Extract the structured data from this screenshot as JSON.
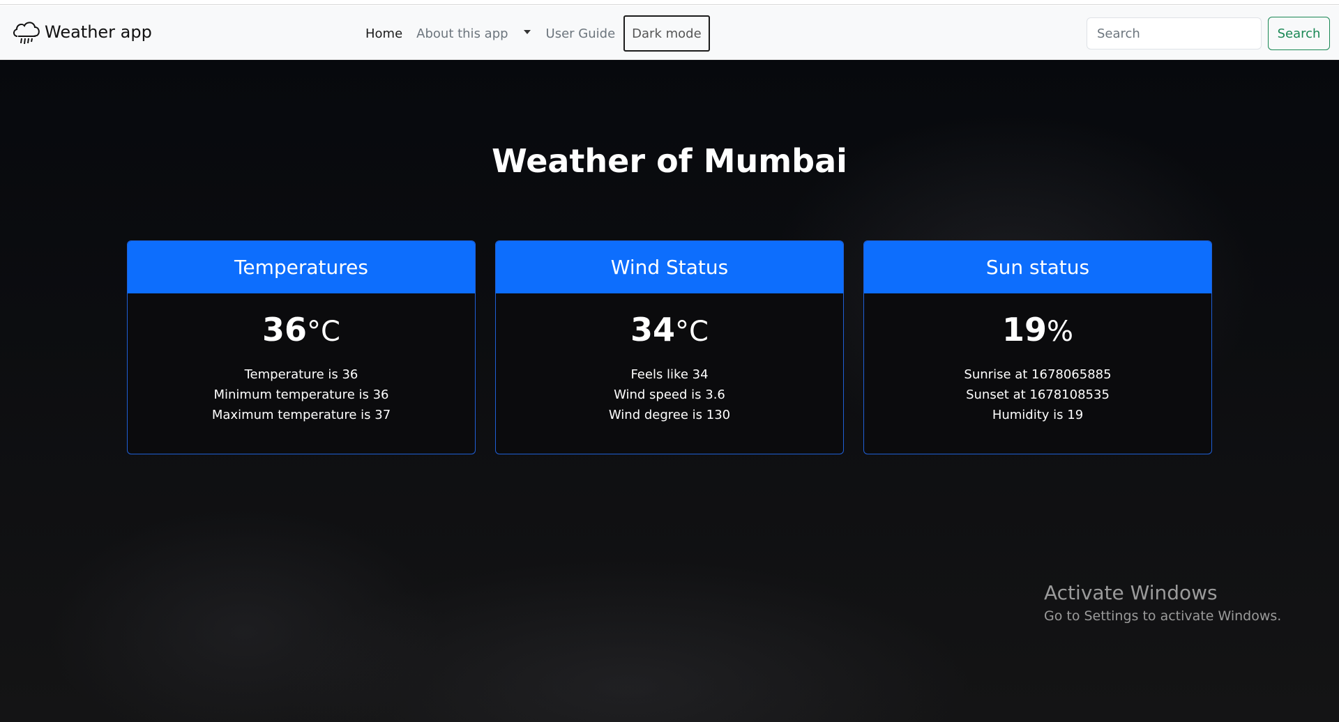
{
  "navbar": {
    "brand": "Weather app",
    "brand_icon": "cloud-rain-icon",
    "links": {
      "home": "Home",
      "about": "About this app",
      "guide": "User Guide"
    },
    "dark_mode_label": "Dark mode",
    "search": {
      "placeholder": "Search",
      "value": ""
    },
    "search_button": "Search"
  },
  "main": {
    "title": "Weather of Mumbai",
    "cards": [
      {
        "header": "Temperatures",
        "value": "36",
        "unit": "°C",
        "lines": [
          "Temperature is 36",
          "Minimum temperature is 36",
          "Maximum temperature is 37"
        ]
      },
      {
        "header": "Wind Status",
        "value": "34",
        "unit": "°C",
        "lines": [
          "Feels like 34",
          "Wind speed is 3.6",
          "Wind degree is 130"
        ]
      },
      {
        "header": "Sun status",
        "value": "19",
        "unit": "%",
        "lines": [
          "Sunrise at 1678065885",
          "Sunset at 1678108535",
          "Humidity is 19"
        ]
      }
    ]
  },
  "watermark": {
    "title": "Activate Windows",
    "subtitle": "Go to Settings to activate Windows."
  },
  "colors": {
    "primary": "#0d6efd",
    "success": "#198754",
    "background": "#0c0d10",
    "navbar": "#f8f9fa"
  }
}
